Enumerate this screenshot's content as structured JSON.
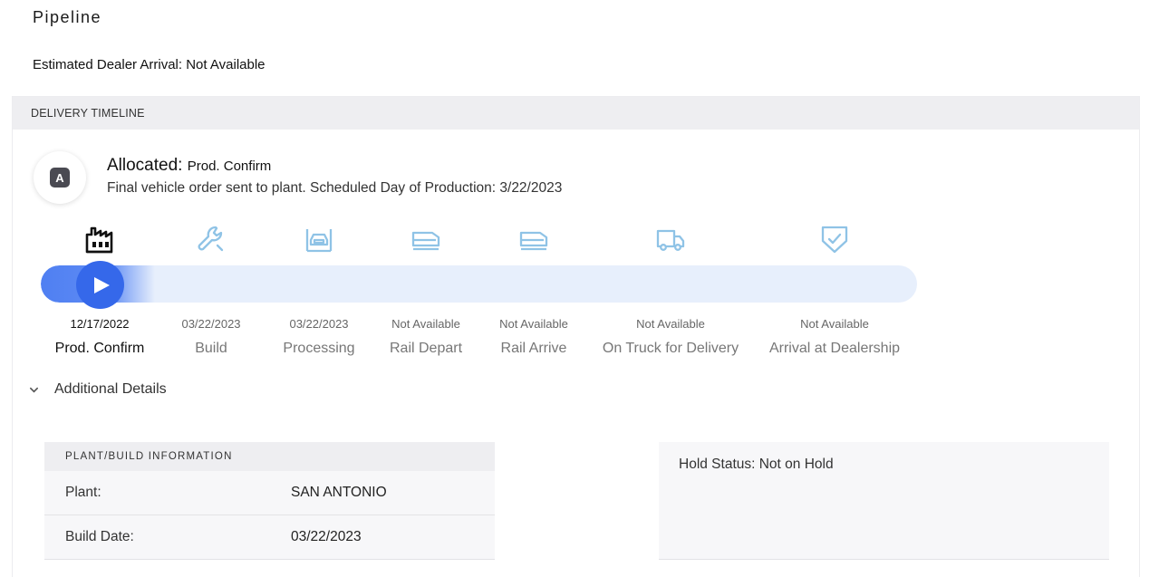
{
  "page": {
    "title": "Pipeline",
    "estimated_arrival": "Estimated Dealer Arrival: Not Available"
  },
  "timeline": {
    "header": "DELIVERY TIMELINE",
    "badge_letter": "A",
    "status_title": "Allocated:",
    "status_stage": "Prod. Confirm",
    "status_description": "Final vehicle order sent to plant. Scheduled Day of Production: 3/22/2023",
    "progress": 0.13,
    "colors": {
      "accent": "#3568ea",
      "track": "#e7effc",
      "icon_inactive": "#8fc3e6",
      "icon_active": "#111111"
    },
    "stages": [
      {
        "label": "Prod. Confirm",
        "date": "12/17/2022",
        "icon": "factory-icon",
        "active": true
      },
      {
        "label": "Build",
        "date": "03/22/2023",
        "icon": "wrench-icon",
        "active": false
      },
      {
        "label": "Processing",
        "date": "03/22/2023",
        "icon": "vehicle-processing-icon",
        "active": false
      },
      {
        "label": "Rail Depart",
        "date": "Not Available",
        "icon": "rail-depart-icon",
        "active": false
      },
      {
        "label": "Rail Arrive",
        "date": "Not Available",
        "icon": "rail-arrive-icon",
        "active": false
      },
      {
        "label": "On Truck for Delivery",
        "date": "Not Available",
        "icon": "truck-icon",
        "active": false
      },
      {
        "label": "Arrival at Dealership",
        "date": "Not Available",
        "icon": "shield-check-icon",
        "active": false
      }
    ]
  },
  "details": {
    "toggle_label": "Additional Details",
    "plant": {
      "header": "PLANT/BUILD INFORMATION",
      "rows": [
        {
          "key": "Plant:",
          "value": "SAN ANTONIO"
        },
        {
          "key": "Build Date:",
          "value": "03/22/2023"
        }
      ]
    },
    "hold_status": "Hold Status: Not on Hold"
  }
}
